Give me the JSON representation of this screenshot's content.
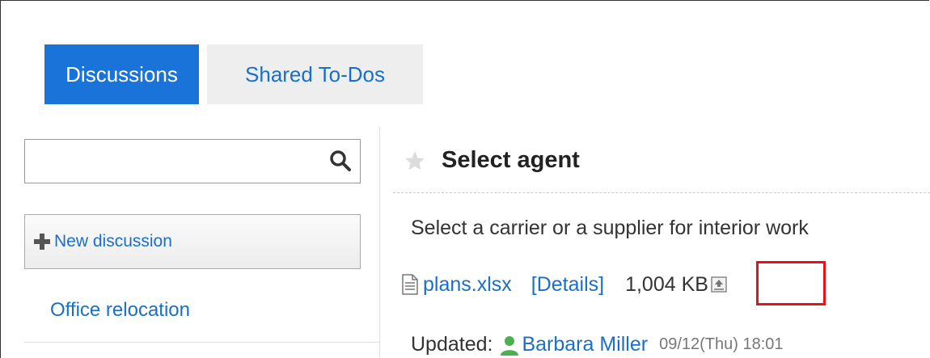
{
  "tabs": [
    {
      "label": "Discussions",
      "active": true
    },
    {
      "label": "Shared To-Dos",
      "active": false
    }
  ],
  "sidebar": {
    "search": {
      "value": "",
      "placeholder": ""
    },
    "new_discussion_label": "New discussion",
    "items": [
      {
        "label": "Office relocation"
      }
    ]
  },
  "discussion": {
    "title": "Select agent",
    "description": "Select a carrier or a supplier for interior work",
    "attachment": {
      "file_name": "plans.xlsx",
      "details_label": "[Details]",
      "size": "1,004 KB"
    },
    "updated": {
      "label": "Updated:",
      "user": "Barbara Miller",
      "timestamp": "09/12(Thu) 18:01"
    }
  },
  "colors": {
    "accent": "#1a73d9",
    "link": "#1a6fc8",
    "highlight": "#e8101a",
    "user_icon": "#4caf50"
  }
}
